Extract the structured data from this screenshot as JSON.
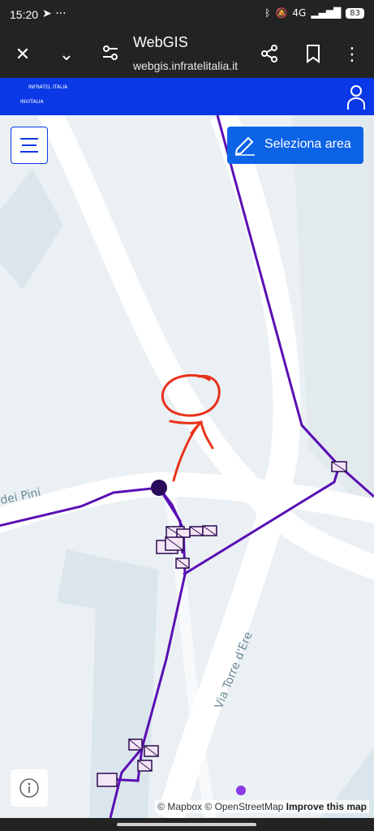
{
  "status_bar": {
    "time": "15:20",
    "left_icons": [
      "telegram-icon",
      "more-dots-icon"
    ],
    "network": "4G",
    "battery": "83"
  },
  "browser": {
    "title": "WebGIS",
    "url": "webgis.infratelitalia.it",
    "icons": [
      "close-icon",
      "chevron-down-icon",
      "tune-icon",
      "share-icon",
      "bookmark-icon",
      "more-vert-icon"
    ]
  },
  "app_header": {
    "logo_line1": "INFRATEL ITALIA",
    "logo_line2": "INVITALIA",
    "brand_color": "#0b38e6"
  },
  "map": {
    "select_area_label": "Seleziona area",
    "streets": [
      "dei Pini",
      "Via Torre d'Ere"
    ],
    "attribution_mapbox": "© Mapbox",
    "attribution_osm": "© OpenStreetMap",
    "attribution_improve": "Improve this map",
    "network_color": "#5a0fb4",
    "annotation_color": "#e8321c"
  }
}
